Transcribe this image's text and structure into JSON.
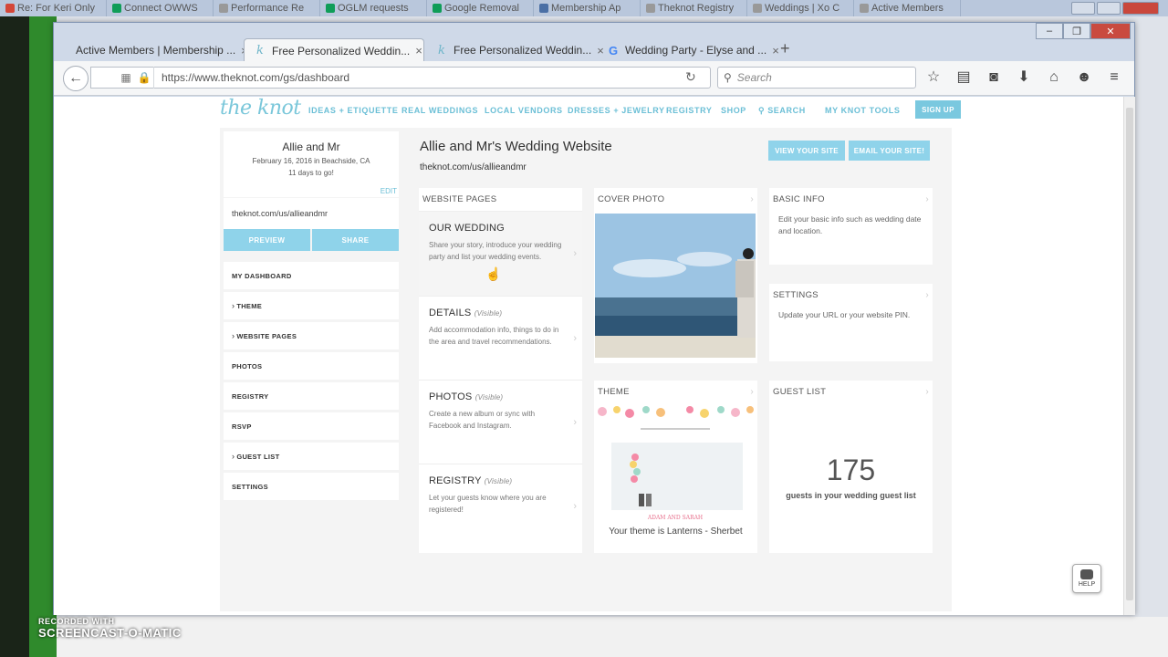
{
  "bg_tabs": [
    {
      "label": "Re: For Keri Only",
      "color": "#d44638"
    },
    {
      "label": "Connect OWWS",
      "color": "#0f9d58"
    },
    {
      "label": "Performance Re",
      "color": "#999999"
    },
    {
      "label": "OGLM requests",
      "color": "#0f9d58"
    },
    {
      "label": "Google Removal",
      "color": "#0f9d58"
    },
    {
      "label": "Membership Ap",
      "color": "#4a6fa5"
    },
    {
      "label": "Theknot Registry",
      "color": "#999999"
    },
    {
      "label": "Weddings | Xo C",
      "color": "#999999"
    },
    {
      "label": "Active Members",
      "color": "#999999"
    }
  ],
  "browser": {
    "tabs": [
      {
        "label": "Active Members | Membership ..."
      },
      {
        "label": "Free Personalized Weddin..."
      },
      {
        "label": "Free Personalized Weddin..."
      },
      {
        "label": "Wedding Party - Elyse and ..."
      }
    ],
    "new_tab": "+",
    "url": "https://www.theknot.com/gs/dashboard",
    "search_placeholder": "Search"
  },
  "site": {
    "logo": "the knot",
    "nav": [
      "IDEAS + ETIQUETTE",
      "REAL WEDDINGS",
      "LOCAL VENDORS",
      "DRESSES + JEWELRY",
      "REGISTRY",
      "SHOP",
      "SEARCH",
      "MY KNOT TOOLS"
    ],
    "signup": "SIGN UP"
  },
  "sidebar": {
    "names": "Allie and Mr",
    "date": "February 16, 2016 in Beachside, CA",
    "countdown": "11 days to go!",
    "edit": "EDIT",
    "site_url": "theknot.com/us/allieandmr",
    "preview": "PREVIEW",
    "share": "SHARE",
    "menu": [
      {
        "label": "MY DASHBOARD",
        "caret": ""
      },
      {
        "label": "THEME",
        "caret": "›"
      },
      {
        "label": "WEBSITE PAGES",
        "caret": "›"
      },
      {
        "label": "PHOTOS",
        "caret": ""
      },
      {
        "label": "REGISTRY",
        "caret": ""
      },
      {
        "label": "RSVP",
        "caret": ""
      },
      {
        "label": "GUEST LIST",
        "caret": "›"
      },
      {
        "label": "SETTINGS",
        "caret": ""
      }
    ]
  },
  "main": {
    "title": "Allie and Mr's Wedding Website",
    "subtitle": "theknot.com/us/allieandmr",
    "view_site": "VIEW YOUR SITE",
    "email_site": "EMAIL YOUR SITE!",
    "website_pages": {
      "heading": "WEBSITE PAGES",
      "items": [
        {
          "title": "OUR WEDDING",
          "tag": "",
          "desc": "Share your story, introduce your wedding party and list your wedding events."
        },
        {
          "title": "DETAILS",
          "tag": "(Visible)",
          "desc": "Add accommodation info, things to do in the area and travel recommendations."
        },
        {
          "title": "PHOTOS",
          "tag": "(Visible)",
          "desc": "Create a new album or sync with Facebook and Instagram."
        },
        {
          "title": "REGISTRY",
          "tag": "(Visible)",
          "desc": "Let your guests know where you are registered!"
        }
      ]
    },
    "cover_photo": {
      "heading": "COVER PHOTO"
    },
    "basic_info": {
      "heading": "BASIC INFO",
      "desc": "Edit your basic info such as wedding date and location."
    },
    "settings": {
      "heading": "SETTINGS",
      "desc": "Update your URL or your website PIN."
    },
    "theme": {
      "heading": "THEME",
      "caption": "Your theme is Lanterns - Sherbet",
      "preview_names": "ADAM AND SARAH"
    },
    "guest_list": {
      "heading": "GUEST LIST",
      "count": "175",
      "label": "guests in your wedding guest list"
    }
  },
  "help": "HELP",
  "watermark": {
    "line1": "RECORDED WITH",
    "line2": "SCREENCAST-O-MATIC"
  },
  "chevron": "›"
}
